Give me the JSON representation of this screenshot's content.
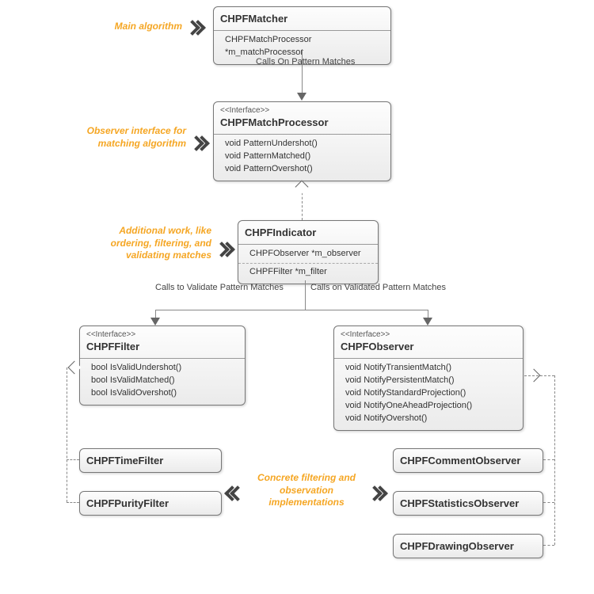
{
  "notes": {
    "main_algo": "Main algorithm",
    "observer_iface": "Observer interface for matching algorithm",
    "additional_work": "Additional work, like ordering, filtering, and validating matches",
    "concrete_impl": "Concrete filtering and observation implementations"
  },
  "edge_labels": {
    "calls_on_pattern": "Calls On Pattern Matches",
    "validate": "Calls to Validate Pattern Matches",
    "validated": "Calls on Validated Pattern Matches"
  },
  "boxes": {
    "matcher": {
      "title": "CHPFMatcher",
      "members": [
        "CHPFMatchProcessor *m_matchProcessor"
      ]
    },
    "match_processor": {
      "stereo": "<<Interface>>",
      "title": "CHPFMatchProcessor",
      "members": [
        "void PatternUndershot()",
        "void PatternMatched()",
        "void PatternOvershot()"
      ]
    },
    "indicator": {
      "title": "CHPFIndicator",
      "members": [
        "CHPFObserver *m_observer",
        "CHPFFilter *m_filter"
      ]
    },
    "filter_iface": {
      "stereo": "<<Interface>>",
      "title": "CHPFFilter",
      "members": [
        "bool IsValidUndershot()",
        "bool IsValidMatched()",
        "bool IsValidOvershot()"
      ]
    },
    "observer_iface": {
      "stereo": "<<Interface>>",
      "title": "CHPFObserver",
      "members": [
        "void NotifyTransientMatch()",
        "void NotifyPersistentMatch()",
        "void NotifyStandardProjection()",
        "void NotifyOneAheadProjection()",
        "void NotifyOvershot()"
      ]
    },
    "time_filter": {
      "title": "CHPFTimeFilter"
    },
    "purity_filter": {
      "title": "CHPFPurityFilter"
    },
    "comment_observer": {
      "title": "CHPFCommentObserver"
    },
    "statistics_observer": {
      "title": "CHPFStatisticsObserver"
    },
    "drawing_observer": {
      "title": "CHPFDrawingObserver"
    }
  }
}
